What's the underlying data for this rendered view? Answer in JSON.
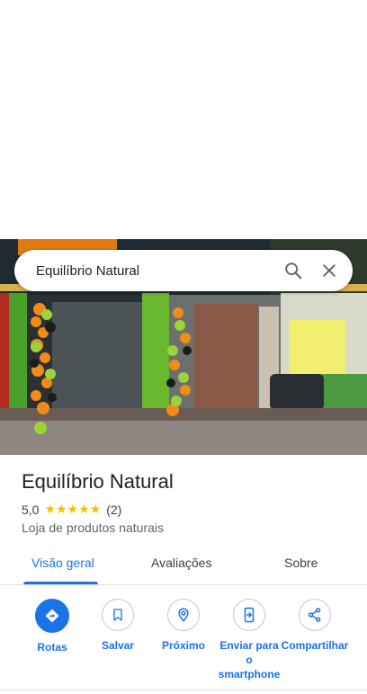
{
  "search": {
    "query": "Equilíbrio Natural"
  },
  "place": {
    "name": "Equilíbrio Natural",
    "rating": "5,0",
    "stars": "★★★★★",
    "review_count": "(2)",
    "category": "Loja de produtos naturais"
  },
  "tabs": [
    {
      "label": "Visão geral",
      "active": true
    },
    {
      "label": "Avaliações",
      "active": false
    },
    {
      "label": "Sobre",
      "active": false
    }
  ],
  "actions": [
    {
      "label": "Rotas",
      "icon": "directions-icon"
    },
    {
      "label": "Salvar",
      "icon": "bookmark-icon"
    },
    {
      "label": "Próximo",
      "icon": "nearby-icon"
    },
    {
      "label": "Enviar para o smartphone",
      "icon": "send-to-phone-icon"
    },
    {
      "label": "Compartilhar",
      "icon": "share-icon"
    }
  ],
  "colors": {
    "accent": "#1a73e8",
    "star": "#fbbc04"
  }
}
